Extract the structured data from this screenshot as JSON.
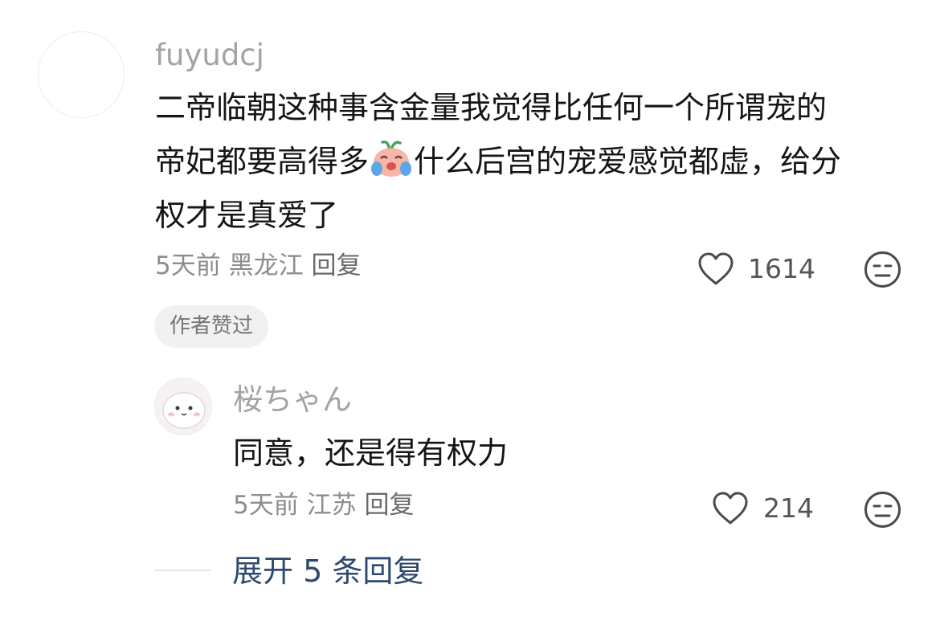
{
  "main_comment": {
    "username": "fuyudcj",
    "text_line1": "二帝临朝这种事含金量我觉得比任何一个所谓宠的",
    "text_line2_before_emoji": "帝妃都要高得多",
    "emoji": "crying-laughing-radish-emoji",
    "text_line2_after_emoji": "什么后宫的宠爱感觉都虚，给分",
    "text_line3": "权才是真爱了",
    "time": "5天前",
    "location": "黑龙江",
    "reply_label": "回复",
    "like_count": "1614",
    "author_badge": "作者赞过",
    "icons": [
      "heart-outline-icon",
      "meh-face-icon"
    ]
  },
  "reply_comment": {
    "username": "桜ちゃん",
    "text": "同意，还是得有权力",
    "time": "5天前",
    "location": "江苏",
    "reply_label": "回复",
    "like_count": "214",
    "icons": [
      "heart-outline-icon",
      "meh-face-icon"
    ]
  },
  "expand_replies": {
    "label": "展开 5 条回复"
  },
  "colors": {
    "link": "#2f4a70",
    "username": "#a3a3a3",
    "text": "#151515",
    "meta": "#8d8d8d"
  }
}
